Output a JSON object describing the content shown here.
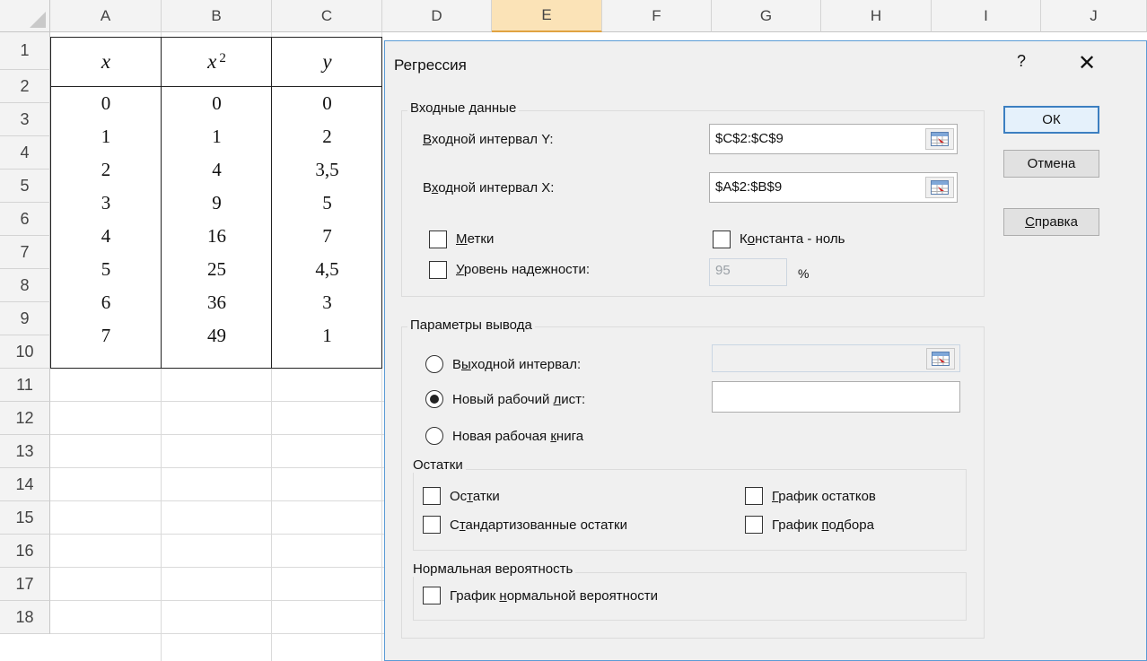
{
  "columns": [
    "A",
    "B",
    "C",
    "D",
    "E",
    "F",
    "G",
    "H",
    "I",
    "J"
  ],
  "rows": [
    "1",
    "2",
    "3",
    "4",
    "5",
    "6",
    "7",
    "8",
    "9",
    "10",
    "11",
    "12",
    "13",
    "14",
    "15",
    "16",
    "17",
    "18"
  ],
  "table": {
    "headers": [
      "x",
      "x",
      "y"
    ],
    "x2_superscript": "2",
    "data": [
      [
        "0",
        "0",
        "0"
      ],
      [
        "1",
        "1",
        "2"
      ],
      [
        "2",
        "4",
        "3,5"
      ],
      [
        "3",
        "9",
        "5"
      ],
      [
        "4",
        "16",
        "7"
      ],
      [
        "5",
        "25",
        "4,5"
      ],
      [
        "6",
        "36",
        "3"
      ],
      [
        "7",
        "49",
        "1"
      ]
    ]
  },
  "dialog": {
    "title": "Регрессия",
    "help": "?",
    "close": "✕",
    "input_group": "Входные данные",
    "input_y_label_u": "В",
    "input_y_label_rest": "ходной интервал Y:",
    "input_y_value": "$C$2:$C$9",
    "input_x_label_pre": "В",
    "input_x_label_u": "х",
    "input_x_label_rest": "одной интервал X:",
    "input_x_value": "$A$2:$B$9",
    "labels_u": "М",
    "labels_rest": "етки",
    "const_pre": "К",
    "const_u": "о",
    "const_rest": "нстанта - ноль",
    "conf_u": "У",
    "conf_rest": "ровень надежности:",
    "conf_value": "95",
    "conf_unit": "%",
    "output_group": "Параметры вывода",
    "out_range_pre": "В",
    "out_range_u": "ы",
    "out_range_rest": "ходной интервал:",
    "new_sheet_pre": "Новый рабочий ",
    "new_sheet_u": "л",
    "new_sheet_rest": "ист:",
    "new_book_pre": "Новая рабочая ",
    "new_book_u": "к",
    "new_book_rest": "нига",
    "resid_group": "Остатки",
    "resid_pre": "Ос",
    "resid_u": "т",
    "resid_rest": "атки",
    "std_resid_pre": "С",
    "std_resid_u": "т",
    "std_resid_rest": "андартизованные остатки",
    "resid_plot_u": "Г",
    "resid_plot_rest": "рафик остатков",
    "fit_plot_pre": "График ",
    "fit_plot_u": "п",
    "fit_plot_rest": "одбора",
    "normal_group": "Нормальная вероятность",
    "normal_plot_pre": "График ",
    "normal_plot_u": "н",
    "normal_plot_rest": "ормальной вероятности",
    "ok": "ОК",
    "cancel": "Отмена",
    "help_btn_u": "С",
    "help_btn_rest": "правка"
  }
}
